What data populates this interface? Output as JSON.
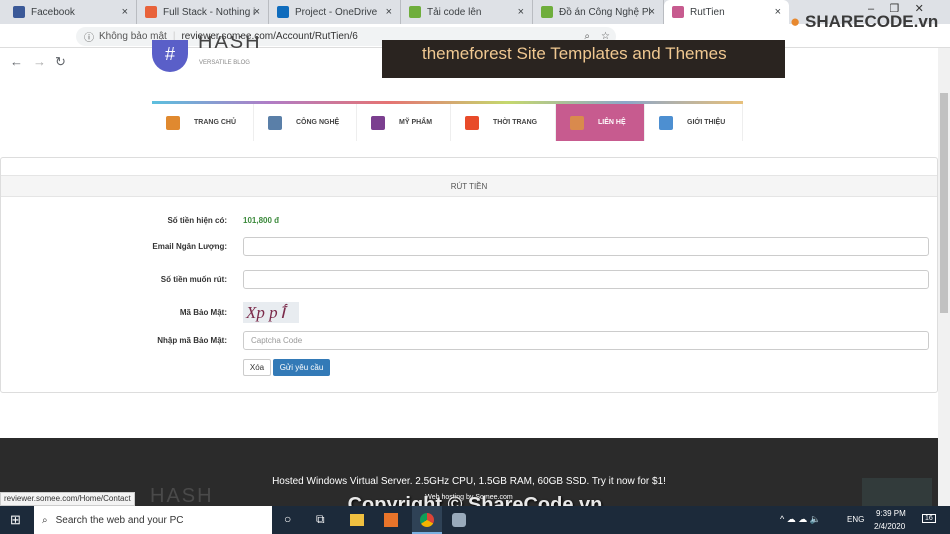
{
  "browser": {
    "tabs": [
      {
        "title": "Facebook",
        "color": "#3b5998",
        "icon": "facebook-icon"
      },
      {
        "title": "Full Stack - Nothing is i",
        "color": "#e8623a",
        "icon": "fullstack-icon"
      },
      {
        "title": "Project - OneDrive",
        "color": "#0f6cbd",
        "icon": "onedrive-icon"
      },
      {
        "title": "Tải code lên",
        "color": "#6fae3c",
        "icon": "sharecode-icon"
      },
      {
        "title": "Đồ án Công Nghệ Phầi",
        "color": "#6fae3c",
        "icon": "sharecode-icon"
      },
      {
        "title": "RutTien",
        "color": "#c75b8f",
        "icon": "h-icon"
      }
    ],
    "security": "Không bảo mật",
    "url": "reviewer.somee.com/Account/RutTien/6",
    "status_url": "reviewer.somee.com/Home/Contact"
  },
  "site": {
    "logo_text": "HASH",
    "logo_sub": "VERSATILE BLOG",
    "banner_text": "themeforest  Site Templates and Themes",
    "nav": [
      {
        "label": "TRANG CHỦ",
        "color": "#5bc0de",
        "icon": "home-icon",
        "ic": "#e0892f"
      },
      {
        "label": "CÔNG NGHỆ",
        "color": "#b07cc6",
        "icon": "phone-icon",
        "ic": "#5a7fa8"
      },
      {
        "label": "MỸ PHẨM",
        "color": "#e57373",
        "icon": "lipstick-icon",
        "ic": "#7b3f8f"
      },
      {
        "label": "THỜI TRANG",
        "color": "#c5d86d",
        "icon": "dress-icon",
        "ic": "#e84b2a"
      },
      {
        "label": "LIÊN HỆ",
        "color": "#8da7c9",
        "icon": "contact-icon",
        "ic": "#d98a4d",
        "active": true
      },
      {
        "label": "GIỚI THIỆU",
        "color": "#e8c07a",
        "icon": "info-icon",
        "ic": "#4d8fd1"
      }
    ],
    "active_color": "#c75b8f"
  },
  "form": {
    "title": "RÚT TIỀN",
    "balance_label": "Số tiền hiện có:",
    "balance": "101,800 đ",
    "email_label": "Email Ngân Lượng:",
    "amount_label": "Số tiền muốn rút:",
    "captcha_label": "Mã Bảo Mật:",
    "captcha_text": "Xp pٲ",
    "captcha_input_label": "Nhập mã Bảo Mật:",
    "captcha_placeholder": "Captcha Code",
    "clear": "Xóa",
    "submit": "Gửi yêu cầu"
  },
  "footer": {
    "ad": "Hosted Windows Virtual Server. 2.5GHz CPU, 1.5GB RAM, 60GB SSD. Try it now for $1!",
    "hosting": "Web hosting by Somee.com"
  },
  "watermark": {
    "logo": "SHARECODE.vn",
    "copyright": "Copyright © ShareCode.vn"
  },
  "taskbar": {
    "search": "Search the web and your PC",
    "lang": "ENG",
    "time": "9:39 PM",
    "date": "2/4/2020",
    "notifications": "16"
  }
}
